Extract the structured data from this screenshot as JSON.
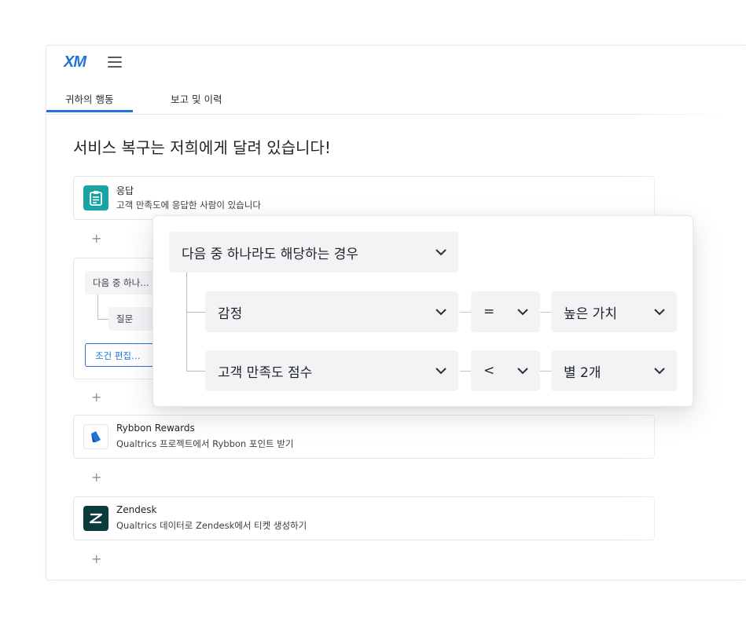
{
  "app": {
    "logo": "XM",
    "tabs": [
      "귀하의 행동",
      "보고 및 이력"
    ],
    "active_tab": 0,
    "page_title": "서비스 복구는 저희에게 달려 있습니다!"
  },
  "workflow": {
    "trigger": {
      "name": "응답",
      "desc": "고객 만족도에 응답한 사람이 있습니다",
      "icon": "clipboard-icon",
      "color": "#1aa3a3"
    },
    "condition_card": {
      "any_label": "다음 중 하나…",
      "question_label": "질문",
      "edit_button": "조건 편집…"
    },
    "tasks": [
      {
        "name": "Rybbon Rewards",
        "desc": "Qualtrics 프로젝트에서 Rybbon 포인트 받기",
        "icon": "rybbon-icon",
        "color": "#1f74d6"
      },
      {
        "name": "Zendesk",
        "desc": "Qualtrics 데이터로 Zendesk에서 티켓 생성하기",
        "icon": "zendesk-icon",
        "color": "#0b3b3c"
      }
    ],
    "plus": "+"
  },
  "condition_panel": {
    "group": "다음 중 하나라도 해당하는 경우",
    "rows": [
      {
        "field": "감정",
        "operator": "=",
        "value": "높은 가치"
      },
      {
        "field": "고객 만족도 점수",
        "operator": "<",
        "value": "별 2개"
      }
    ]
  }
}
